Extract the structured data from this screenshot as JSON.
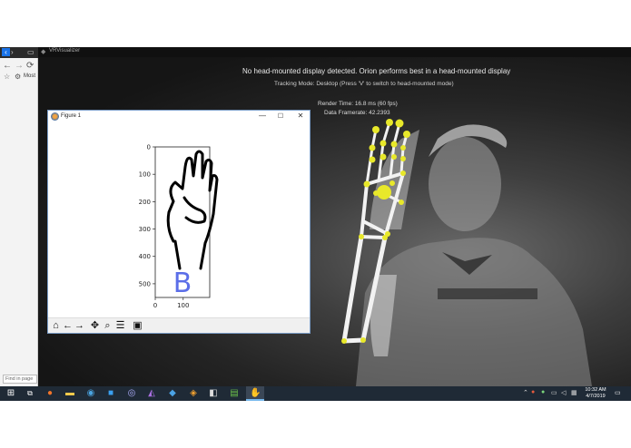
{
  "browser": {
    "nav_left": "‹",
    "nav_right": "›",
    "back_icon": "←",
    "forward_icon": "→",
    "reload_icon": "⟳",
    "star_icon": "☆",
    "gear_icon": "⚙",
    "bookmark_label": "Most",
    "find_placeholder": "Find in page"
  },
  "visualizer": {
    "title": "VRVisualizer",
    "warning": "No head-mounted display detected. Orion performs best in a head-mounted display",
    "tracking_mode": "Tracking Mode: Desktop (Press 'V' to switch to head-mounted mode)",
    "render_time": "Render Time: 16.8 ms (60 fps)",
    "data_framerate": "Data Framerate: 42.2393"
  },
  "figure": {
    "title": "Figure 1",
    "min_icon": "—",
    "max_icon": "☐",
    "close_icon": "✕",
    "predicted_letter": "B",
    "letter_color": "#5b6ee8",
    "y_ticks": [
      "0",
      "100",
      "200",
      "300",
      "400",
      "500"
    ],
    "x_ticks": [
      "0",
      "100"
    ],
    "toolbar": [
      "home-icon",
      "back-arrow-icon",
      "forward-arrow-icon",
      "pan-icon",
      "zoom-icon",
      "configure-icon",
      "save-icon"
    ]
  },
  "taskbar": {
    "time": "10:32 AM",
    "date": "4/7/2019",
    "apps": [
      "firefox-icon",
      "file-explorer-icon",
      "chrome-icon",
      "store-icon",
      "app-icon",
      "visual-studio-icon",
      "git-icon",
      "unity-icon",
      "notepad-icon",
      "app-icon-2",
      "leap-motion-icon"
    ]
  }
}
